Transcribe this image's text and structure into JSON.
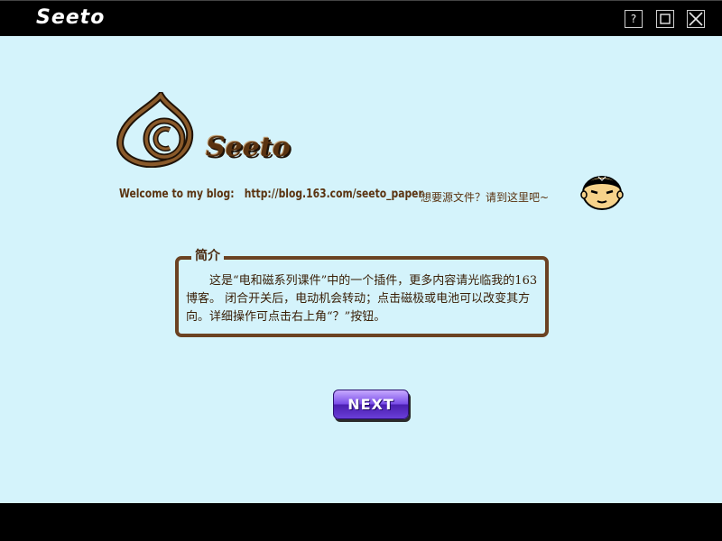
{
  "app": {
    "title": "Seeto"
  },
  "window_controls": {
    "help_label": "?",
    "maximize_icon": "square-icon",
    "close_icon": "x-icon"
  },
  "logo": {
    "text": "Seeto"
  },
  "welcome": {
    "prefix": "Welcome to my blog:",
    "url": "http://blog.163.com/seeto_paper",
    "source_prompt": "想要源文件？请到这里吧~"
  },
  "intro": {
    "heading": "简介",
    "body": "这是“电和磁系列课件”中的一个插件，更多内容请光临我的163博客。 闭合开关后，电动机会转动；点击磁极或电池可以改变其方向。详细操作可点击右上角“？”按钮。"
  },
  "buttons": {
    "next_label": "NEXT"
  },
  "colors": {
    "background": "#d4f3fb",
    "bars": "#000000",
    "brown": "#5a3310",
    "next_button": "#6a3ed8"
  }
}
